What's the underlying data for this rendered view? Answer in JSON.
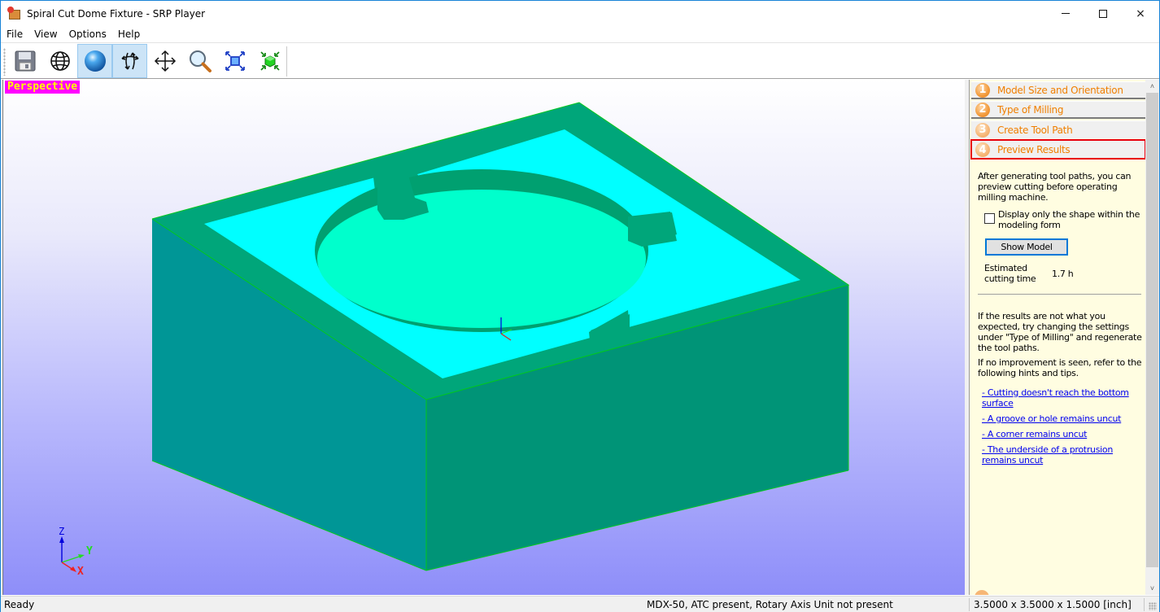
{
  "window": {
    "title": "Spiral Cut Dome Fixture - SRP Player",
    "controls": {
      "minimize": "minimize",
      "maximize": "maximize",
      "close": "×"
    }
  },
  "menu": [
    "File",
    "View",
    "Options",
    "Help"
  ],
  "toolbar": {
    "buttons": [
      {
        "name": "save",
        "icon": "floppy-disk-icon",
        "active": false
      },
      {
        "name": "wireframe-view",
        "icon": "globe-wireframe-icon",
        "active": false
      },
      {
        "name": "solid-view",
        "icon": "shaded-sphere-icon",
        "active": true
      },
      {
        "name": "rotate",
        "icon": "rotate-arrows-icon",
        "active": true
      },
      {
        "name": "pan",
        "icon": "move-arrows-icon",
        "active": false
      },
      {
        "name": "zoom",
        "icon": "magnifier-icon",
        "active": false
      },
      {
        "name": "fit-view",
        "icon": "fit-expand-icon",
        "active": false
      },
      {
        "name": "zoom-to-model",
        "icon": "green-cube-contract-icon",
        "active": false
      }
    ]
  },
  "viewport": {
    "view_label": "Perspective",
    "axes": {
      "z": "Z",
      "y": "Y",
      "x": "X"
    },
    "colors": {
      "side_left": "#009696",
      "side_right": "#009477",
      "top_rim": "#00a67a",
      "pocket_floor": "#00ffff",
      "circle_floor": "#00ffcc",
      "edge": "#00c81e",
      "label_bg": "#ff00ff",
      "label_fg": "#ffff00"
    }
  },
  "panel": {
    "steps": [
      {
        "num": "1",
        "label": "Model Size and Orientation",
        "selected": false
      },
      {
        "num": "2",
        "label": "Type of Milling",
        "selected": false
      },
      {
        "num": "3",
        "label": "Create Tool Path",
        "selected": false
      },
      {
        "num": "4",
        "label": "Preview Results",
        "selected": true
      }
    ],
    "intro": "After generating tool paths, you can preview cutting before operating milling machine.",
    "checkbox_label": "Display only the shape within the modeling form",
    "checkbox_checked": false,
    "show_model_button": "Show Model",
    "estimated_label": "Estimated cutting time",
    "estimated_value": "1.7  h",
    "hint1": "If the results are not what you expected, try changing the settings under \"Type of Milling\" and regenerate the tool paths.",
    "hint2": "If no improvement is seen, refer to the following hints and tips.",
    "links": [
      "- Cutting doesn't reach the bottom surface",
      "- A groove or hole remains uncut",
      "- A corner remains uncut",
      "- The underside of a protrusion remains uncut"
    ],
    "highlight_color": "#e8000d",
    "step_text_color": "#f07f00"
  },
  "statusbar": {
    "left": "Ready",
    "machine": "MDX-50, ATC present, Rotary Axis Unit not present",
    "size": "3.5000 x 3.5000 x 1.5000 [inch]"
  }
}
